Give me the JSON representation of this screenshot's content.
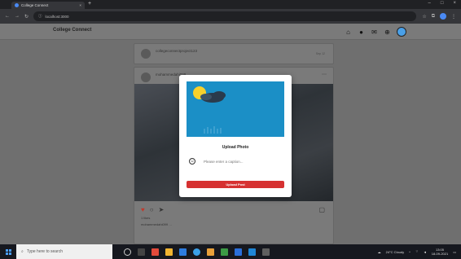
{
  "browser": {
    "tab_title": "College Connect",
    "address": "localhost:3000"
  },
  "app": {
    "brand": "College Connect",
    "header_icons": [
      "home-icon",
      "explore-icon",
      "messenger-icon",
      "new-post-icon",
      "profile-avatar"
    ]
  },
  "feed": {
    "post1": {
      "username": "collegeconnectproject123",
      "subtitle": "",
      "time": "Sep 12"
    },
    "post2": {
      "username": "mohammedahi099",
      "likes": "1 likes",
      "caption": "mohammedahi099 …"
    }
  },
  "modal": {
    "title": "Upload Photo",
    "caption_placeholder": "Please enter a caption...",
    "caption_value": "",
    "upload_label": "Upload Post"
  },
  "taskbar": {
    "search_placeholder": "Type here to search",
    "weather": "24°C  Cloudy",
    "time": "13:05",
    "date": "18-09-2021"
  },
  "colors": {
    "accent_red": "#d63131",
    "preview_blue": "#1b8fc6"
  }
}
